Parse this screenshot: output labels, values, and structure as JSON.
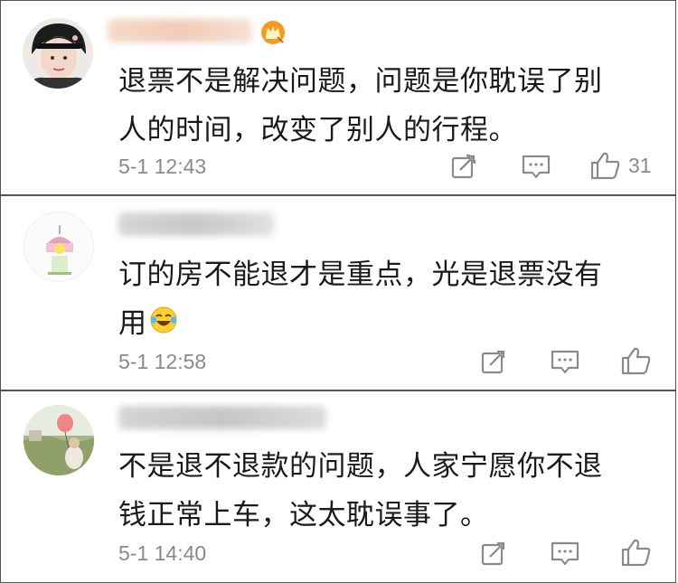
{
  "comments": [
    {
      "content_lines": [
        "退票不是解决问题，问题是你耽误了别",
        "人的时间，改变了别人的行程。"
      ],
      "time": "5-1 12:43",
      "like_count": "31",
      "has_vip_badge": true
    },
    {
      "content_lines": [
        "订的房不能退才是重点，光是退票没有",
        "用"
      ],
      "time": "5-1 12:58",
      "like_count": "",
      "has_emoji": "laughing-crying-emoji"
    },
    {
      "content_lines": [
        "不是退不退款的问题，人家宁愿你不退",
        "钱正常上车，这太耽误事了。"
      ],
      "time": "5-1 14:40",
      "like_count": ""
    }
  ],
  "icons": {
    "share": "share-icon",
    "reply": "comment-icon",
    "like": "thumbs-up-icon",
    "vip": "crown-badge-icon"
  },
  "colors": {
    "text": "#1a1a1a",
    "meta": "#8a8a8a",
    "border": "#555555",
    "vip_orange": "#f59a23"
  }
}
